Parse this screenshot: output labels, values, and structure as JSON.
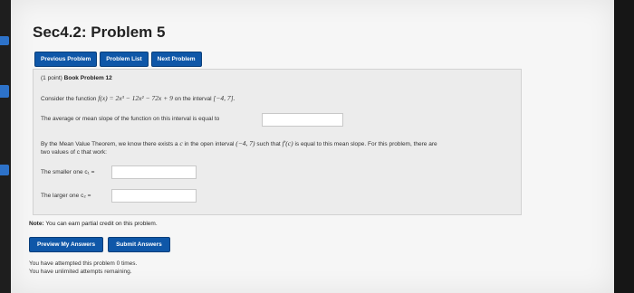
{
  "title": "Sec4.2: Problem 5",
  "nav": {
    "previous": "Previous Problem",
    "list": "Problem List",
    "next": "Next Problem"
  },
  "problem": {
    "header_points": "(1 point)",
    "header_name": "Book Problem 12",
    "consider_prefix": "Consider the function",
    "function_expr": "f(x) = 2x³ − 12x² − 72x + 9",
    "interval_text": "on the interval",
    "interval": "[−4, 7].",
    "avg_slope_label": "The average or mean slope of the function on this interval is equal to",
    "mvt_line1_a": "By the Mean Value Theorem, we know there exists a",
    "mvt_c": "c",
    "mvt_line1_b": "in the open interval",
    "mvt_open_interval": "(−4, 7)",
    "mvt_line1_c": "such that",
    "mvt_fprime": "f′(c)",
    "mvt_line1_d": "is equal to this mean slope. For this problem, there are",
    "mvt_line2": "two values of c that work:",
    "smaller_label": "The smaller one c₁ =",
    "larger_label": "The larger one c₂ =",
    "avg_slope_value": "",
    "smaller_value": "",
    "larger_value": ""
  },
  "note_bold": "Note:",
  "note_text": "You can earn partial credit on this problem.",
  "actions": {
    "preview": "Preview My Answers",
    "submit": "Submit Answers"
  },
  "status": {
    "attempts": "You have attempted this problem 0 times.",
    "remaining": "You have unlimited attempts remaining."
  }
}
